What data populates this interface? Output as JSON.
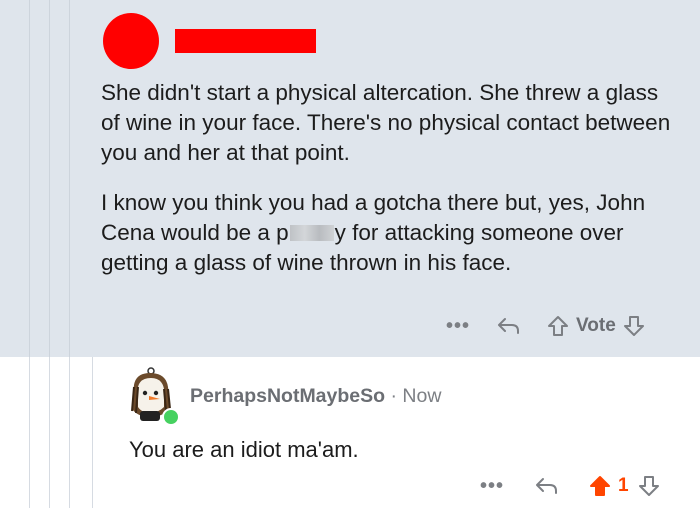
{
  "parent_comment": {
    "paragraph_1": "She didn't start a physical altercation. She threw a glass of wine in your face. There's no physical contact between you and her at that point.",
    "paragraph_2_before": "I know you think you had a gotcha there but, yes, John Cena would be a p",
    "paragraph_2_after": "y for attacking someone over getting a glass of wine thrown in his face.",
    "vote_label": "Vote",
    "more_label": "•••"
  },
  "reply_comment": {
    "author": "PerhapsNotMaybeSo",
    "separator": " · ",
    "timestamp": "Now",
    "text": "You are an idiot ma'am.",
    "upvotes": "1",
    "more_label": "•••"
  },
  "colors": {
    "parent_bg": "#dfe5ec",
    "redaction": "#ff0000",
    "upvote_active": "#ff4500",
    "online": "#46d160"
  }
}
